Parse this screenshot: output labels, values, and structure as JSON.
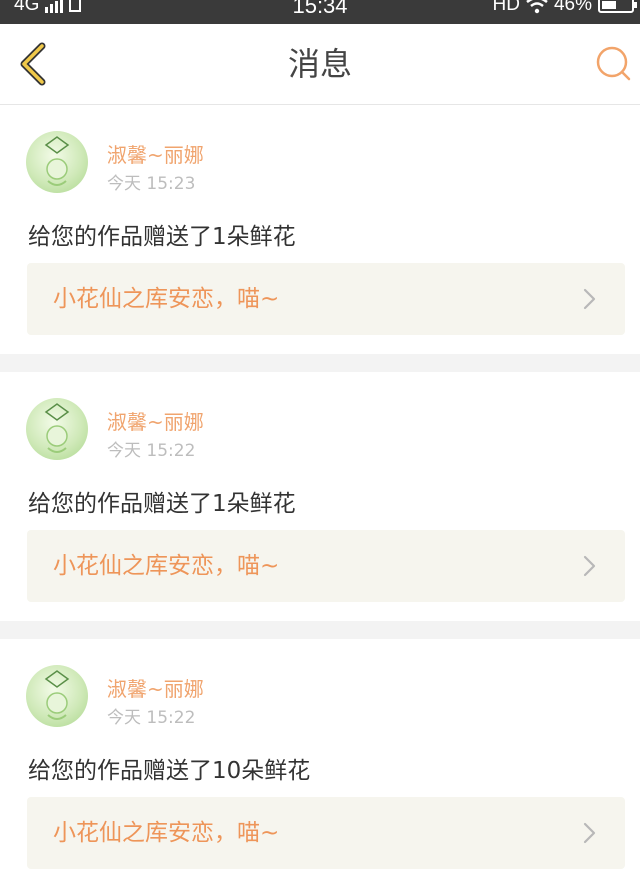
{
  "status_bar": {
    "network": "4G",
    "time": "15:34",
    "hd": "HD",
    "battery": "46%"
  },
  "header": {
    "title": "消息",
    "back_icon": "chevron-left-icon",
    "search_icon": "search-icon"
  },
  "messages": [
    {
      "user_name": "淑馨~丽娜",
      "time": "今天 15:23",
      "text": "给您的作品赠送了1朵鲜花",
      "work_title": "小花仙之库安恋，喵~"
    },
    {
      "user_name": "淑馨~丽娜",
      "time": "今天 15:22",
      "text": "给您的作品赠送了1朵鲜花",
      "work_title": "小花仙之库安恋，喵~"
    },
    {
      "user_name": "淑馨~丽娜",
      "time": "今天 15:22",
      "text": "给您的作品赠送了10朵鲜花",
      "work_title": "小花仙之库安恋，喵~"
    }
  ],
  "colors": {
    "accent": "#ee9559",
    "username": "#f0a46e",
    "back_icon": "#f0c94a",
    "search_icon": "#f2a46a",
    "ref_bg": "#f6f5ee"
  }
}
